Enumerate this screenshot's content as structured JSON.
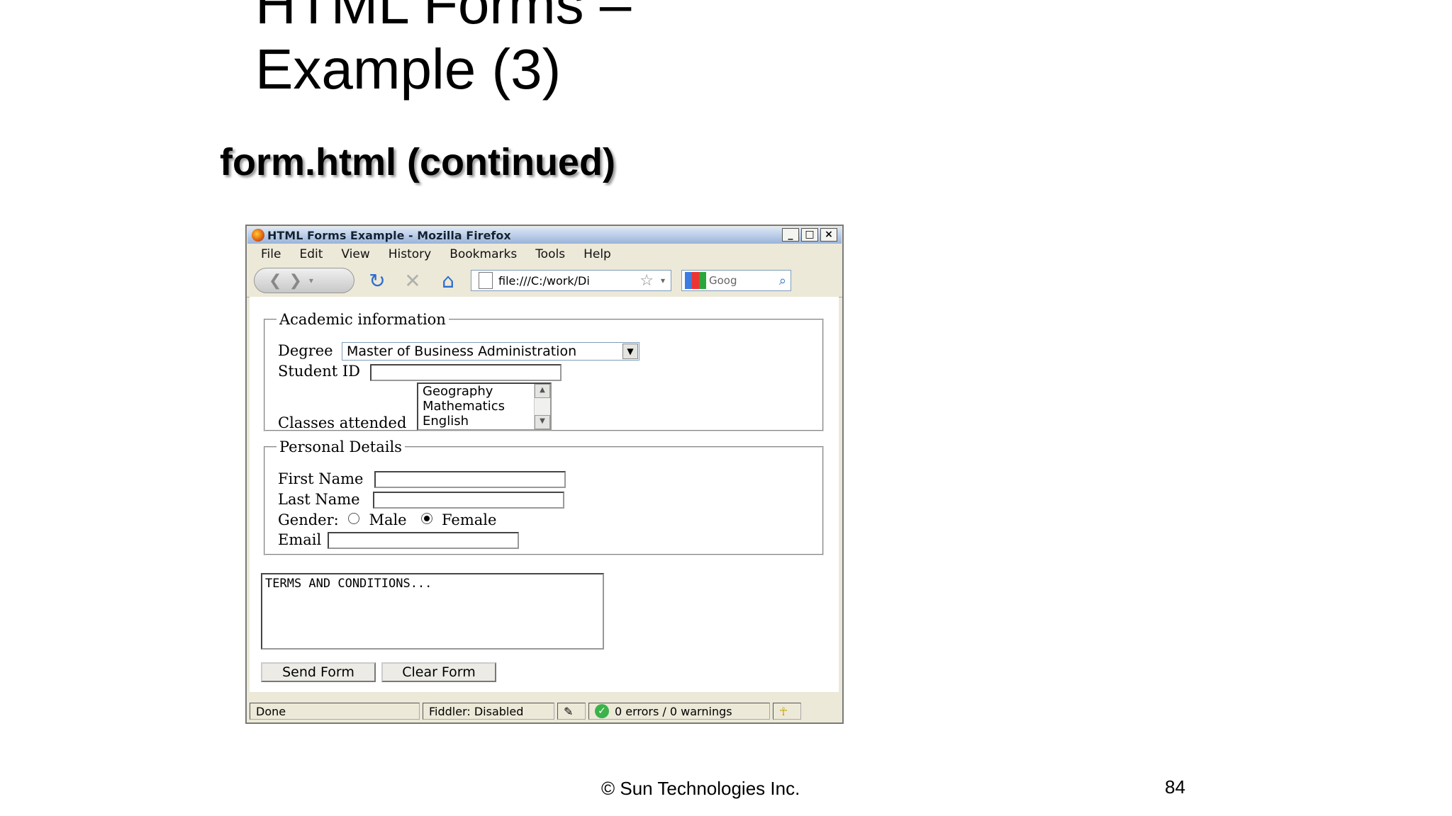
{
  "slide": {
    "title_line1": "HTML Forms –",
    "title_line2": "Example (3)",
    "subtitle": "form.html (continued)",
    "footer": "© Sun Technologies Inc.",
    "page_number": "84"
  },
  "browser": {
    "window_title": "HTML Forms Example - Mozilla Firefox",
    "window_buttons": [
      "_",
      "□",
      "×"
    ],
    "menu": [
      "File",
      "Edit",
      "View",
      "History",
      "Bookmarks",
      "Tools",
      "Help"
    ],
    "url": "file:///C:/work/Di",
    "search_placeholder": "Goog"
  },
  "form": {
    "academic": {
      "legend": "Academic information",
      "degree_label": "Degree",
      "degree_value": "Master of Business Administration",
      "student_id_label": "Student ID",
      "student_id_value": "",
      "classes_label": "Classes attended",
      "classes_options": [
        "Geography",
        "Mathematics",
        "English"
      ]
    },
    "personal": {
      "legend": "Personal Details",
      "first_name_label": "First Name",
      "last_name_label": "Last Name",
      "gender_label": "Gender:",
      "gender_options": [
        "Male",
        "Female"
      ],
      "gender_selected": "Female",
      "email_label": "Email"
    },
    "terms_text": "TERMS AND CONDITIONS...",
    "send_button": "Send Form",
    "clear_button": "Clear Form"
  },
  "status": {
    "done": "Done",
    "fiddler": "Fiddler: Disabled",
    "validation": "0 errors / 0 warnings"
  }
}
